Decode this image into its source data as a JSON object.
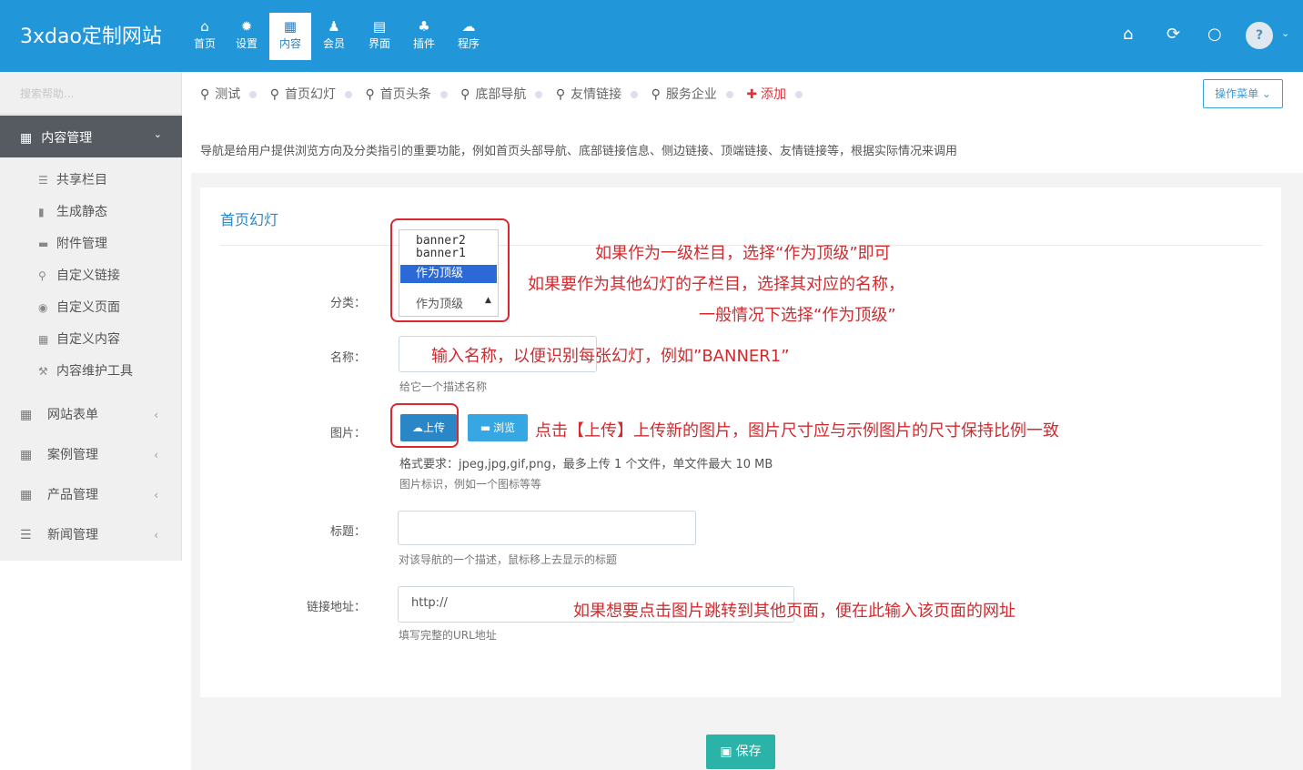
{
  "brand": "3xdao定制网站",
  "nav": [
    {
      "label": "首页",
      "icon": "home-icon",
      "glyph": "⌂"
    },
    {
      "label": "设置",
      "icon": "gear-icon",
      "glyph": "✹"
    },
    {
      "label": "内容",
      "icon": "grid-icon",
      "glyph": "▦"
    },
    {
      "label": "会员",
      "icon": "user-icon",
      "glyph": "♟"
    },
    {
      "label": "界面",
      "icon": "doc-icon",
      "glyph": "▤"
    },
    {
      "label": "插件",
      "icon": "plugin-icon",
      "glyph": "♣"
    },
    {
      "label": "程序",
      "icon": "cloud-icon",
      "glyph": "☁"
    }
  ],
  "header_right": {
    "home": "⌂",
    "refresh": "⟳",
    "power": "○",
    "avatar": "?",
    "caret": "⌄"
  },
  "sidebar": {
    "search_placeholder": "搜索帮助...",
    "section": "内容管理",
    "section_icon": "▦",
    "section_chevron": "⌄",
    "items": [
      {
        "label": "共享栏目",
        "glyph": "☰"
      },
      {
        "label": "生成静态",
        "glyph": "▮"
      },
      {
        "label": "附件管理",
        "glyph": "▬"
      },
      {
        "label": "自定义链接",
        "glyph": "⚲"
      },
      {
        "label": "自定义页面",
        "glyph": "◉"
      },
      {
        "label": "自定义内容",
        "glyph": "▦"
      },
      {
        "label": "内容维护工具",
        "glyph": "⚒"
      }
    ],
    "groups": [
      {
        "label": "网站表单",
        "glyph": "▦",
        "chevron": "‹"
      },
      {
        "label": "案例管理",
        "glyph": "▦",
        "chevron": "‹"
      },
      {
        "label": "产品管理",
        "glyph": "▦",
        "chevron": "‹"
      },
      {
        "label": "新闻管理",
        "glyph": "☰",
        "chevron": "‹"
      }
    ]
  },
  "breadcrumbs": [
    "测试",
    "首页幻灯",
    "首页头条",
    "底部导航",
    "友情链接",
    "服务企业"
  ],
  "crumb_pin": "⚲",
  "add_label": "添加",
  "add_glyph": "✚",
  "op_menu": "操作菜单 ⌄",
  "description": "导航是给用户提供浏览方向及分类指引的重要功能，例如首页头部导航、底部链接信息、侧边链接、顶端链接、友情链接等，根据实际情况来调用",
  "form": {
    "title": "首页幻灯",
    "category_label": "分类：",
    "category_options": [
      "banner2",
      "banner1",
      "作为顶级"
    ],
    "category_value": "作为顶级",
    "category_arrow": "▲",
    "name_label": "名称：",
    "name_help": "给它一个描述名称",
    "image_label": "图片：",
    "upload_btn": "上传",
    "upload_glyph": "☁",
    "browse_btn": "浏览",
    "browse_glyph": "▬",
    "format_help": "格式要求：jpeg,jpg,gif,png，最多上传 1 个文件，单文件最大 10 MB",
    "image_help": "图片标识，例如一个图标等等",
    "title_label": "标题：",
    "title_help": "对该导航的一个描述，鼠标移上去显示的标题",
    "link_label": "链接地址：",
    "link_value": "http://",
    "link_help": "填写完整的URL地址",
    "save_btn": "保存",
    "save_glyph": "▣"
  },
  "annotations": {
    "a1": "如果作为一级栏目，选择“作为顶级”即可",
    "a2": "如果要作为其他幻灯的子栏目，选择其对应的名称，",
    "a3": "一般情况下选择“作为顶级”",
    "a4": "输入名称，以便识别每张幻灯，例如”BANNER1”",
    "a5": "点击【上传】上传新的图片，图片尺寸应与示例图片的尺寸保持比例一致",
    "a6": "如果想要点击图片跳转到其他页面，便在此输入该页面的网址"
  },
  "colors": {
    "header": "#2196d9",
    "annotation": "#d02b2f",
    "save": "#2ab3a6",
    "upload": "#2a86c6",
    "browse": "#37a7e4"
  }
}
